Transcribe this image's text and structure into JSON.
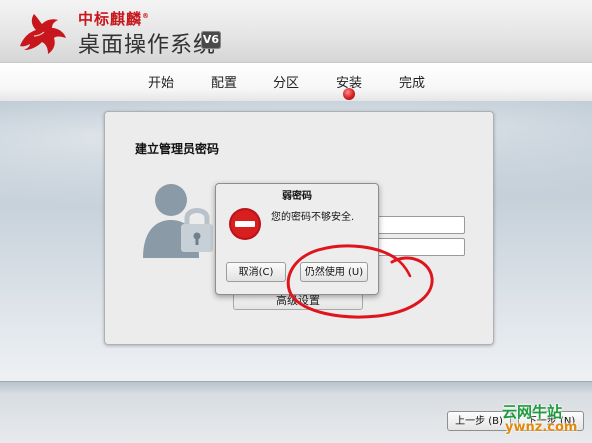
{
  "header": {
    "brand_name": "中标麒麟",
    "trademark": "®",
    "product_name": "桌面操作系统",
    "version_badge": "V6"
  },
  "steps": {
    "items": [
      "开始",
      "配置",
      "分区",
      "安装",
      "完成"
    ],
    "current": "安装"
  },
  "panel": {
    "title": "建立管理员密码",
    "advanced_button": "高级设置"
  },
  "dialog": {
    "title": "弱密码",
    "message": "您的密码不够安全.",
    "cancel_button": "取消(C)",
    "use_anyway_button": "仍然使用 (U)"
  },
  "nav": {
    "prev_button": "上一步 (B)",
    "next_button": "下一步 (N)"
  },
  "watermark": {
    "line1": "云网牛站",
    "line2": "ywnz.com"
  },
  "colors": {
    "brand_red": "#c8161d",
    "annotation_red": "#e0141c",
    "error_icon": "#d81e1e"
  }
}
